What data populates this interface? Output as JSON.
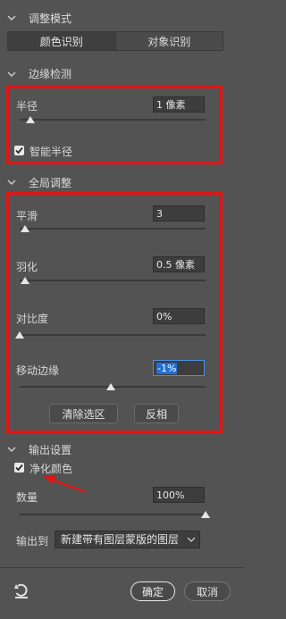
{
  "adjust_mode": {
    "title": "调整模式",
    "tabs": [
      "颜色识别",
      "对象识别"
    ]
  },
  "edge_detection": {
    "title": "边缘检测",
    "radius_label": "半径",
    "radius_value": "1 像素",
    "radius_slider": 0.06,
    "smart_radius_label": "智能半径",
    "smart_radius_checked": true
  },
  "global_refine": {
    "title": "全局调整",
    "smooth_label": "平滑",
    "smooth_value": "3",
    "smooth_slider": 0.03,
    "feather_label": "羽化",
    "feather_value": "0.5 像素",
    "feather_slider": 0.03,
    "contrast_label": "对比度",
    "contrast_value": "0%",
    "contrast_slider": 0.0,
    "shift_edge_label": "移动边缘",
    "shift_edge_value": "-1%",
    "shift_edge_slider": 0.49,
    "clear_selection_label": "清除选区",
    "invert_label": "反相"
  },
  "output": {
    "title": "输出设置",
    "decontaminate_label": "净化颜色",
    "decontaminate_checked": true,
    "amount_label": "数量",
    "amount_value": "100%",
    "amount_slider": 1.0,
    "output_to_label": "输出到",
    "output_to_value": "新建带有图层蒙版的图层"
  },
  "footer": {
    "ok_label": "确定",
    "cancel_label": "取消"
  },
  "colors": {
    "highlight": "#e01414",
    "accent": "#1f6fd6"
  },
  "icons": [
    "chevron-down-icon",
    "checkbox-icon",
    "reset-icon",
    "arrow-annotation-icon"
  ]
}
